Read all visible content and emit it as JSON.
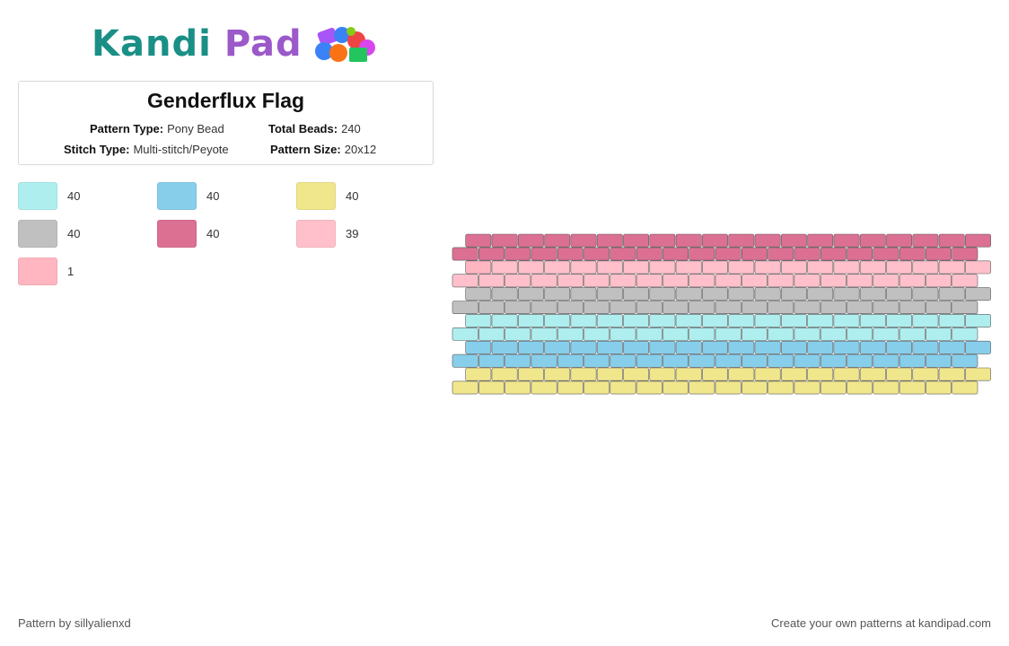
{
  "brand": {
    "name_part1": "Kandi",
    "name_part2": "Pad"
  },
  "pattern": {
    "title": "Genderflux Flag",
    "type_label": "Pattern Type:",
    "type_value": "Pony Bead",
    "beads_label": "Total Beads:",
    "beads_value": "240",
    "stitch_label": "Stitch Type:",
    "stitch_value": "Multi-stitch/Peyote",
    "size_label": "Pattern Size:",
    "size_value": "20x12"
  },
  "legend": [
    {
      "color": "#aeeeee",
      "count": "40"
    },
    {
      "color": "#87ceeb",
      "count": "40"
    },
    {
      "color": "#f0e68c",
      "count": "40"
    },
    {
      "color": "#c0c0c0",
      "count": "40"
    },
    {
      "color": "#db7093",
      "count": "40"
    },
    {
      "color": "#ffc0cb",
      "count": "39"
    },
    {
      "color": "#ffb6c1",
      "count": "1"
    }
  ],
  "grid": {
    "columns": 20,
    "rows": [
      "#db7093",
      "#db7093",
      "#ffc0cb",
      "#ffc0cb",
      "#c0c0c0",
      "#c0c0c0",
      "#aeeeee",
      "#aeeeee",
      "#87ceeb",
      "#87ceeb",
      "#f0e68c",
      "#f0e68c"
    ],
    "special_bead": {
      "row": 2,
      "col": 0,
      "color": "#ffb6c1"
    }
  },
  "footer": {
    "credit": "Pattern by sillyalienxd",
    "promo": "Create your own patterns at kandipad.com"
  }
}
